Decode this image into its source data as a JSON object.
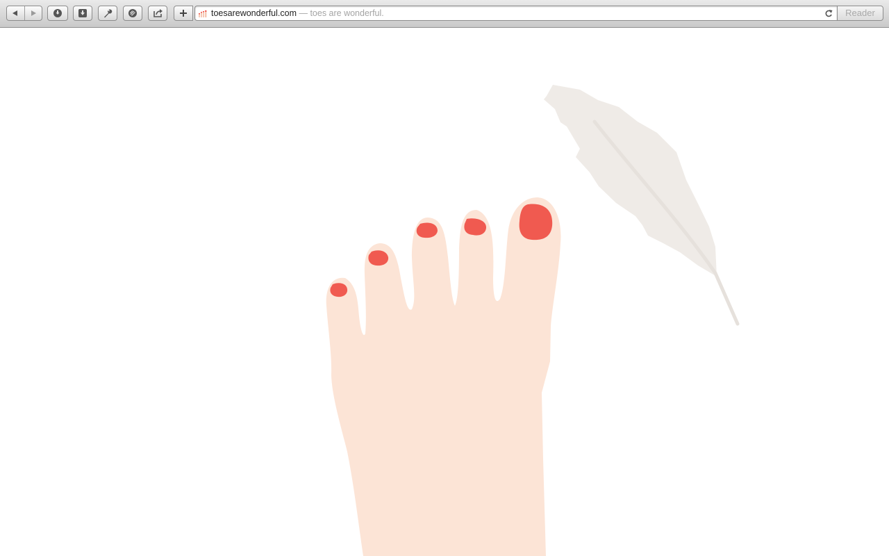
{
  "browser": {
    "url_domain": "toesarewonderful.com",
    "url_separator": " — ",
    "page_title": "toes are wonderful.",
    "reader_label": "Reader",
    "toolbar_icons": [
      "back-icon",
      "forward-icon",
      "top-sites-icon",
      "downloads-icon",
      "wrench-icon",
      "bookmark-icon",
      "share-icon",
      "add-icon",
      "reload-icon"
    ]
  },
  "illustration": {
    "subject": "foot",
    "toe_count": 5,
    "colors": {
      "skin": "#fce4d6",
      "nail_polish": "#f05a50",
      "feather": "#efebe7",
      "feather_shaft": "#e6e1dc"
    }
  }
}
